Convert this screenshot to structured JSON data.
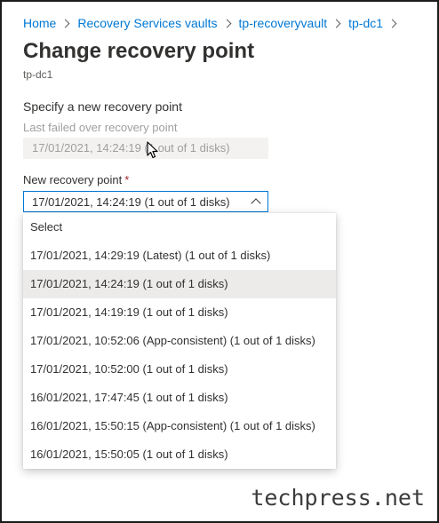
{
  "breadcrumb": {
    "items": [
      "Home",
      "Recovery Services vaults",
      "tp-recoveryvault",
      "tp-dc1"
    ]
  },
  "page": {
    "title": "Change recovery point",
    "subtitle": "tp-dc1"
  },
  "form": {
    "section_heading": "Specify a new recovery point",
    "last_failed_label": "Last failed over recovery point",
    "last_failed_value": "17/01/2021, 14:24:19 (1 out of 1 disks)",
    "new_point_label": "New recovery point",
    "required_mark": "*",
    "selected_value": "17/01/2021, 14:24:19 (1 out of 1 disks)"
  },
  "dropdown": {
    "selected_index": 2,
    "options": [
      "Select",
      "17/01/2021, 14:29:19 (Latest) (1 out of 1 disks)",
      "17/01/2021, 14:24:19 (1 out of 1 disks)",
      "17/01/2021, 14:19:19 (1 out of 1 disks)",
      "17/01/2021, 10:52:06 (App-consistent) (1 out of 1 disks)",
      "17/01/2021, 10:52:00 (1 out of 1 disks)",
      "16/01/2021, 17:47:45 (1 out of 1 disks)",
      "16/01/2021, 15:50:15 (App-consistent) (1 out of 1 disks)",
      "16/01/2021, 15:50:05 (1 out of 1 disks)"
    ]
  },
  "watermark": "techpress.net",
  "colors": {
    "link": "#0078d4",
    "focus_border": "#0078d4",
    "selected_option_bg": "#edebe9",
    "required": "#a4262c"
  }
}
